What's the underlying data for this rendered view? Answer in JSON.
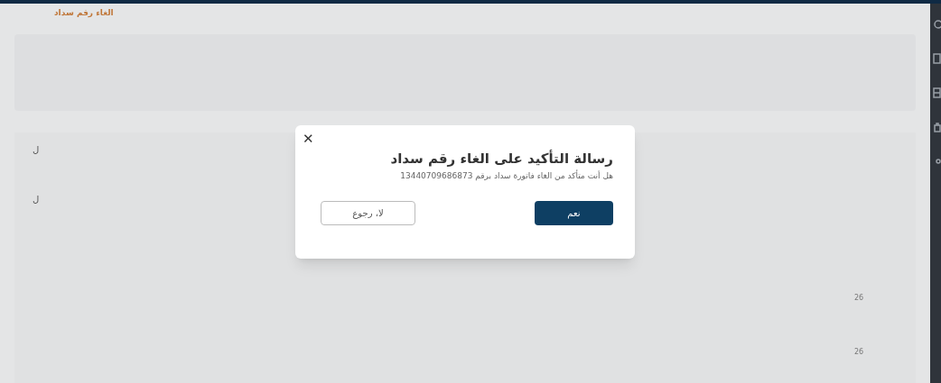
{
  "page": {
    "title": "الغاء رقم سداد"
  },
  "table": {
    "rows": [
      {
        "cell": "ل"
      },
      {
        "cell": "ل"
      }
    ],
    "percent_cells": [
      "26",
      "26"
    ]
  },
  "sidebar": {
    "items": [
      {
        "kind": "circle"
      },
      {
        "kind": "doc"
      },
      {
        "kind": "grid"
      },
      {
        "kind": "bag"
      },
      {
        "kind": "dot"
      }
    ]
  },
  "dialog": {
    "title": "رسالة التأكيد على الغاء رقم سداد",
    "message": "هل أنت متأكد من الغاء فاتورة سداد برقم 13440709686873",
    "close": "✕",
    "buttons": [
      {
        "label": "نعم",
        "kind": "primary"
      },
      {
        "label": "لا، رجوع",
        "kind": "secondary"
      }
    ]
  }
}
